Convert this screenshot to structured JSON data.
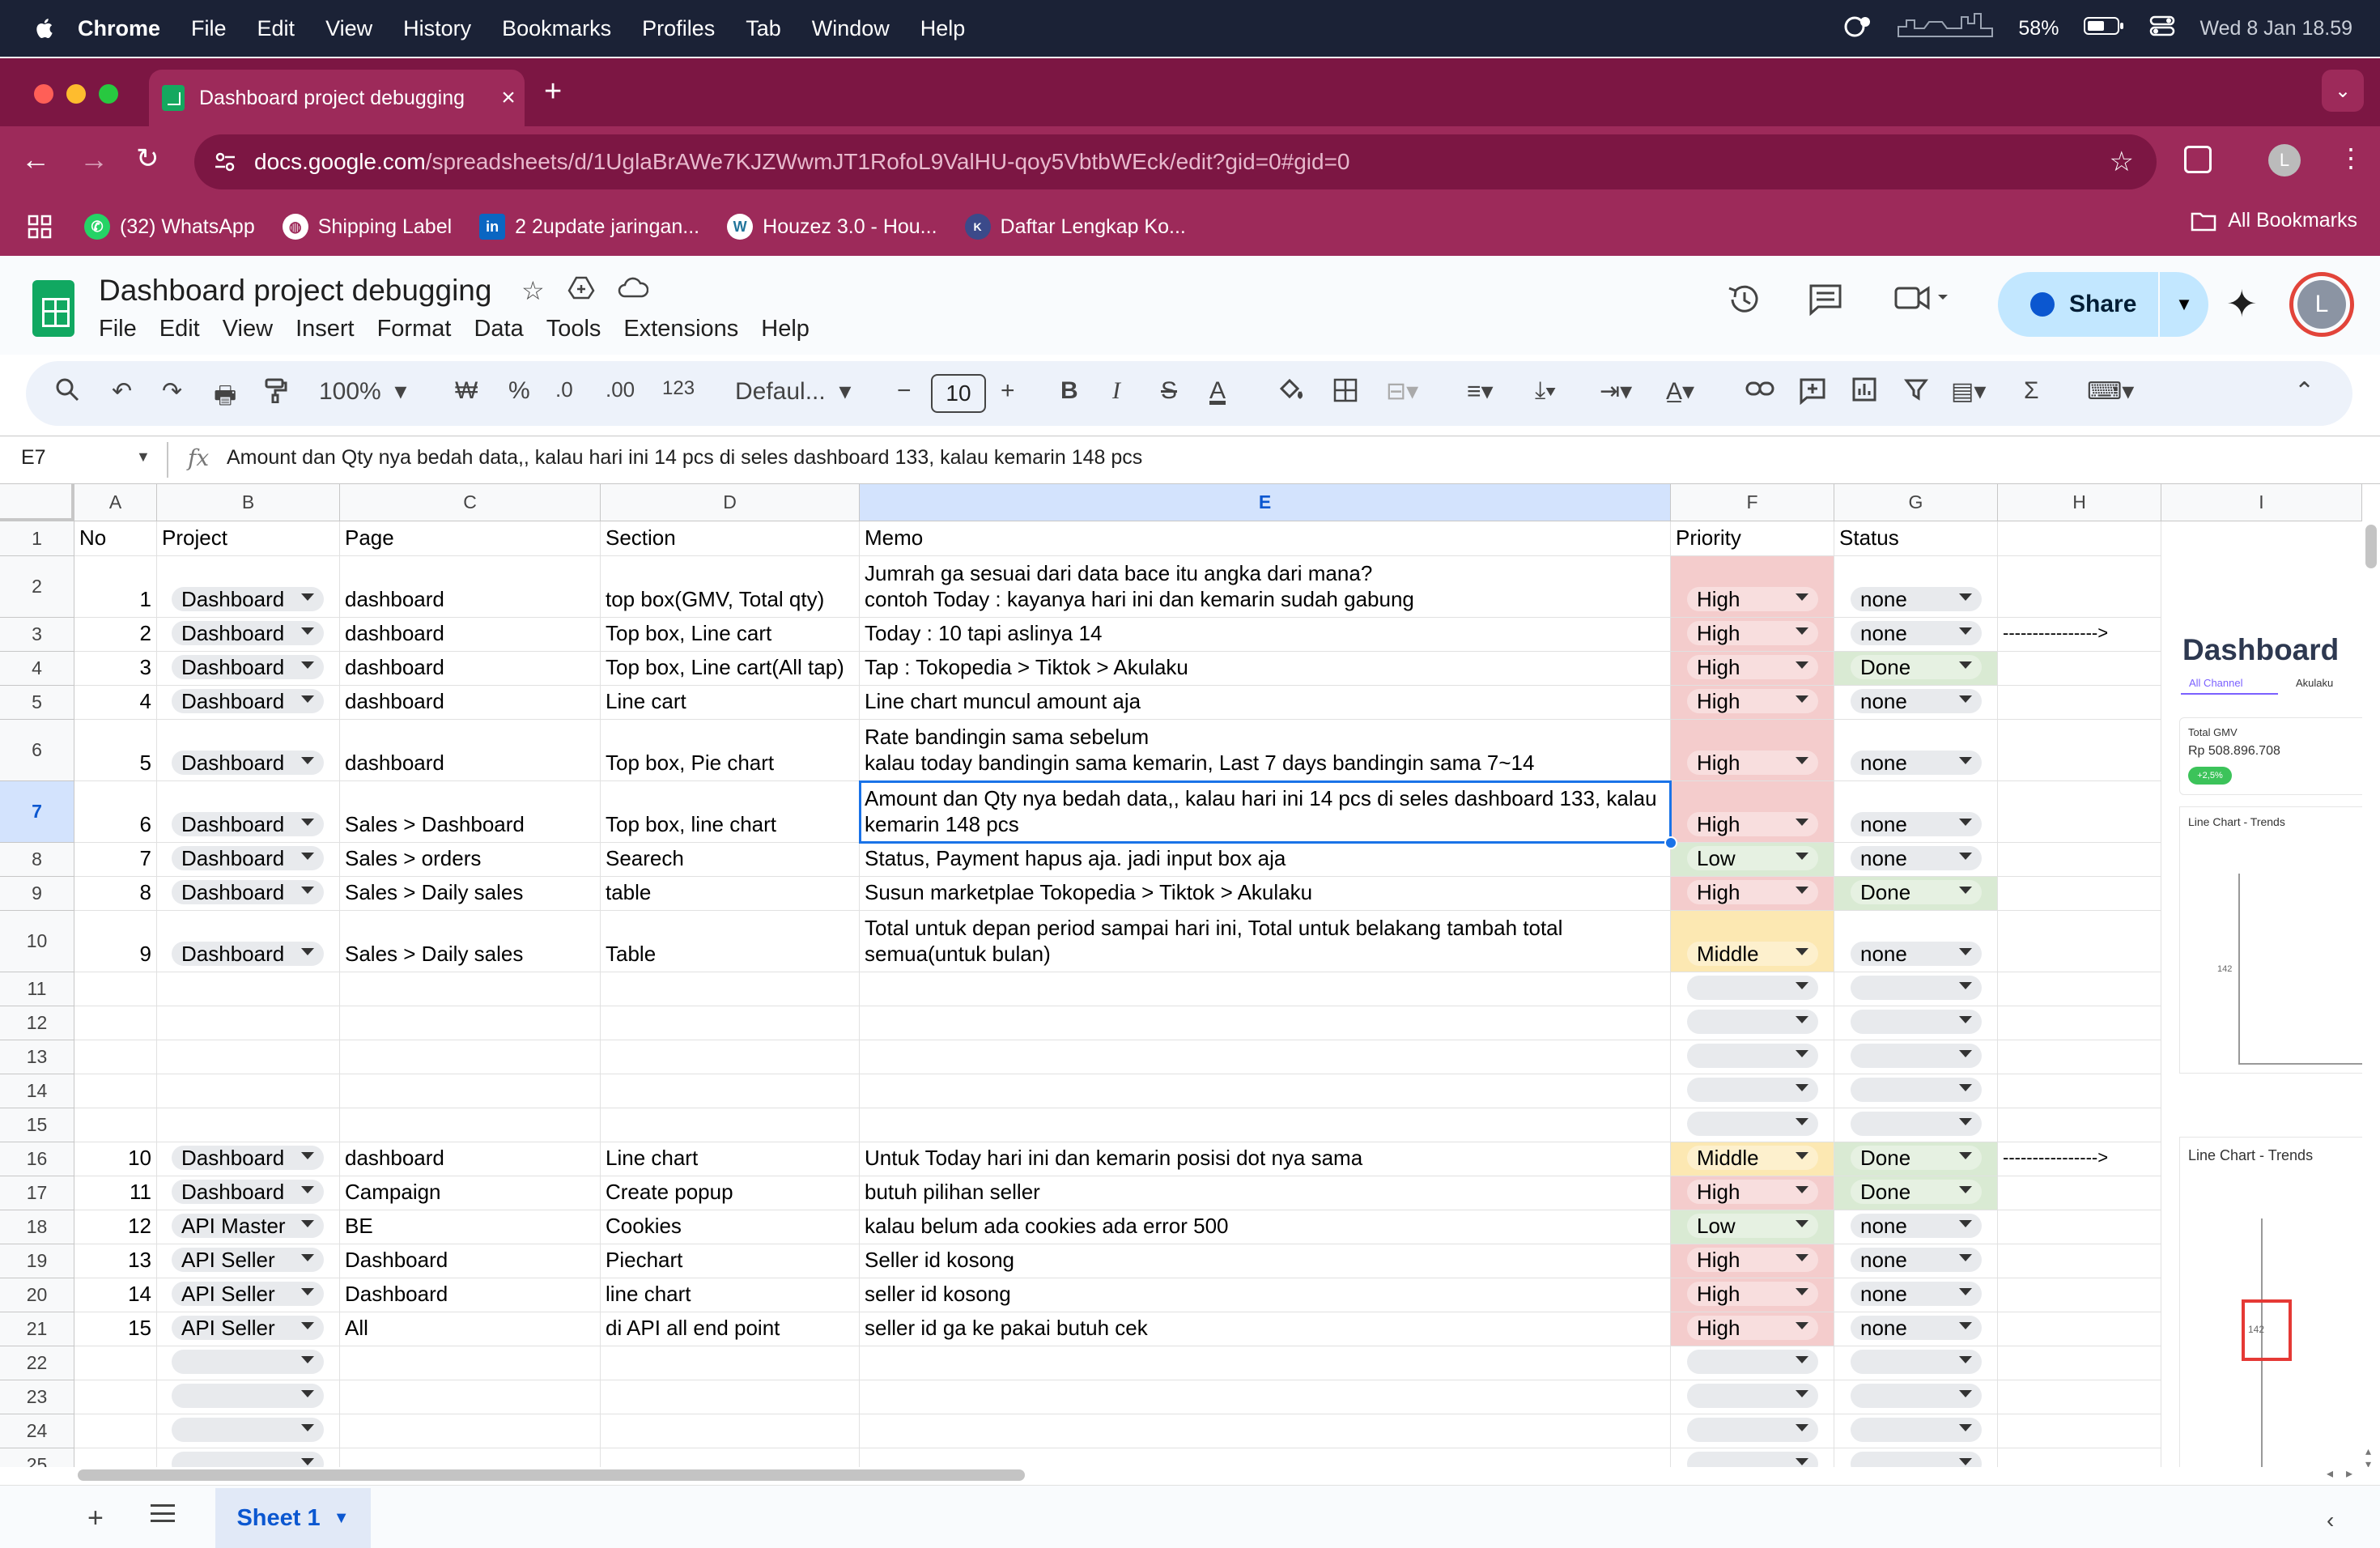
{
  "menubar": {
    "app": "Chrome",
    "items": [
      "File",
      "Edit",
      "View",
      "History",
      "Bookmarks",
      "Profiles",
      "Tab",
      "Window",
      "Help"
    ],
    "battery": "58%",
    "datetime": "Wed 8 Jan  18.59"
  },
  "browser": {
    "tab_title": "Dashboard project debugging",
    "url_host": "docs.google.com",
    "url_path": "/spreadsheets/d/1UglaBrAWe7KJZWwmJT1RofoL9ValHU-qoy5VbtbWEck/edit?gid=0#gid=0",
    "profile_initial": "L",
    "bookmarks": [
      {
        "label": "(32) WhatsApp",
        "icon": "whatsapp-icon",
        "color": "#25d366"
      },
      {
        "label": "Shipping Label",
        "icon": "globe-icon",
        "color": "#ffffff"
      },
      {
        "label": "2 2update jaringan...",
        "icon": "linkedin-icon",
        "color": "#0a66c2"
      },
      {
        "label": "Houzez 3.0 - Hou...",
        "icon": "wordpress-icon",
        "color": "#ffffff"
      },
      {
        "label": "Daftar Lengkap Ko...",
        "icon": "site-icon",
        "color": "#3b4a8a"
      }
    ],
    "all_bookmarks": "All Bookmarks"
  },
  "sheets": {
    "doc_title": "Dashboard project debugging",
    "menu": [
      "File",
      "Edit",
      "View",
      "Insert",
      "Format",
      "Data",
      "Tools",
      "Extensions",
      "Help"
    ],
    "share_label": "Share",
    "avatar_initial": "L",
    "zoom": "100%",
    "currency": "₩",
    "percent": "%",
    "dec_less": ".0",
    "dec_more": ".00",
    "number_format": "123",
    "font": "Defaul...",
    "font_size": "10",
    "name_box": "E7",
    "formula": "Amount dan Qty nya bedah data,, kalau hari ini 14 pcs di seles dashboard 133, kalau kemarin 148 pcs",
    "sheet_name": "Sheet 1"
  },
  "grid": {
    "columns": [
      "A",
      "B",
      "C",
      "D",
      "E",
      "F",
      "G",
      "H",
      "I"
    ],
    "selected_column": "E",
    "selected_row": "7",
    "header": {
      "no": "No",
      "project": "Project",
      "page": "Page",
      "section": "Section",
      "memo": "Memo",
      "priority": "Priority",
      "status": "Status"
    },
    "rows": [
      {
        "row": "2",
        "no": "1",
        "project": "Dashboard",
        "page": "dashboard",
        "section": "top box(GMV, Total qty)",
        "memo": "Jumrah ga sesuai dari data bace itu angka dari mana?\ncontoh Today : kayanya hari ini dan kemarin sudah gabung",
        "priority": "High",
        "status": "none",
        "h": ""
      },
      {
        "row": "3",
        "no": "2",
        "project": "Dashboard",
        "page": "dashboard",
        "section": "Top box, Line cart",
        "memo": "Today : 10 tapi aslinya 14",
        "priority": "High",
        "status": "none",
        "h": "---------------->"
      },
      {
        "row": "4",
        "no": "3",
        "project": "Dashboard",
        "page": "dashboard",
        "section": "Top box, Line cart(All tap)",
        "memo": "Tap : Tokopedia > Tiktok > Akulaku",
        "priority": "High",
        "status": "Done",
        "h": ""
      },
      {
        "row": "5",
        "no": "4",
        "project": "Dashboard",
        "page": "dashboard",
        "section": "Line cart",
        "memo": "Line chart muncul amount aja",
        "priority": "High",
        "status": "none",
        "h": ""
      },
      {
        "row": "6",
        "no": "5",
        "project": "Dashboard",
        "page": "dashboard",
        "section": "Top box, Pie chart",
        "memo": "Rate bandingin sama sebelum\nkalau today bandingin sama kemarin, Last 7 days bandingin sama 7~14",
        "priority": "High",
        "status": "none",
        "h": ""
      },
      {
        "row": "7",
        "no": "6",
        "project": "Dashboard",
        "page": "Sales > Dashboard",
        "section": "Top box, line chart",
        "memo": "Amount dan Qty nya bedah data,, kalau hari ini 14 pcs di seles dashboard 133, kalau kemarin 148 pcs",
        "priority": "High",
        "status": "none",
        "h": ""
      },
      {
        "row": "8",
        "no": "7",
        "project": "Dashboard",
        "page": "Sales > orders",
        "section": "Searech",
        "memo": "Status, Payment hapus aja. jadi input box aja",
        "priority": "Low",
        "status": "none",
        "h": ""
      },
      {
        "row": "9",
        "no": "8",
        "project": "Dashboard",
        "page": "Sales > Daily sales",
        "section": "table",
        "memo": "Susun marketplae Tokopedia > Tiktok > Akulaku",
        "priority": "High",
        "status": "Done",
        "h": ""
      },
      {
        "row": "10",
        "no": "9",
        "project": "Dashboard",
        "page": "Sales > Daily sales",
        "section": "Table",
        "memo": "Total untuk depan period sampai hari ini, Total untuk belakang tambah total semua(untuk bulan)",
        "priority": "Middle",
        "status": "none",
        "h": ""
      },
      {
        "row": "11",
        "no": "",
        "project": "",
        "page": "",
        "section": "",
        "memo": "",
        "priority": "",
        "status": "",
        "h": ""
      },
      {
        "row": "12",
        "no": "",
        "project": "",
        "page": "",
        "section": "",
        "memo": "",
        "priority": "",
        "status": "",
        "h": ""
      },
      {
        "row": "13",
        "no": "",
        "project": "",
        "page": "",
        "section": "",
        "memo": "",
        "priority": "",
        "status": "",
        "h": ""
      },
      {
        "row": "14",
        "no": "",
        "project": "",
        "page": "",
        "section": "",
        "memo": "",
        "priority": "",
        "status": "",
        "h": ""
      },
      {
        "row": "15",
        "no": "",
        "project": "",
        "page": "",
        "section": "",
        "memo": "",
        "priority": "",
        "status": "",
        "h": ""
      },
      {
        "row": "16",
        "no": "10",
        "project": "Dashboard",
        "page": "dashboard",
        "section": "Line chart",
        "memo": "Untuk Today hari ini dan kemarin posisi dot nya sama",
        "priority": "Middle",
        "status": "Done",
        "h": "---------------->"
      },
      {
        "row": "17",
        "no": "11",
        "project": "Dashboard",
        "page": "Campaign",
        "section": "Create popup",
        "memo": "butuh pilihan seller",
        "priority": "High",
        "status": "Done",
        "h": ""
      },
      {
        "row": "18",
        "no": "12",
        "project": "API Master",
        "page": "BE",
        "section": "Cookies",
        "memo": "kalau belum ada cookies ada error 500",
        "priority": "Low",
        "status": "none",
        "h": ""
      },
      {
        "row": "19",
        "no": "13",
        "project": "API Seller",
        "page": "Dashboard",
        "section": "Piechart",
        "memo": "Seller id kosong",
        "priority": "High",
        "status": "none",
        "h": ""
      },
      {
        "row": "20",
        "no": "14",
        "project": "API Seller",
        "page": "Dashboard",
        "section": "line chart",
        "memo": "seller id kosong",
        "priority": "High",
        "status": "none",
        "h": ""
      },
      {
        "row": "21",
        "no": "15",
        "project": "API Seller",
        "page": "All",
        "section": "di API all end point",
        "memo": "seller id ga ke pakai butuh cek",
        "priority": "High",
        "status": "none",
        "h": ""
      },
      {
        "row": "22",
        "no": "",
        "project": "",
        "page": "",
        "section": "",
        "memo": "",
        "priority": "",
        "status": "",
        "h": ""
      },
      {
        "row": "23",
        "no": "",
        "project": "",
        "page": "",
        "section": "",
        "memo": "",
        "priority": "",
        "status": "",
        "h": ""
      },
      {
        "row": "24",
        "no": "",
        "project": "",
        "page": "",
        "section": "",
        "memo": "",
        "priority": "",
        "status": "",
        "h": ""
      },
      {
        "row": "25",
        "no": "",
        "project": "",
        "page": "",
        "section": "",
        "memo": "",
        "priority": "",
        "status": "",
        "h": ""
      }
    ],
    "colors": {
      "High": "#f4cccc",
      "Middle": "#fce8b2",
      "Low": "#d9ead3",
      "Done": "#d9ead3"
    }
  },
  "embedded_image": {
    "title": "Dashboard",
    "tabs": [
      "All Channel",
      "Akulaku"
    ],
    "gmv_label": "Total GMV",
    "gmv_value": "Rp 508.896.708",
    "gmv_change": "+2,5%",
    "chart1_title": "Line Chart - Trends",
    "chart1_tick": "142",
    "chart2_title": "Line Chart - Trends",
    "chart2_tick": "142"
  }
}
